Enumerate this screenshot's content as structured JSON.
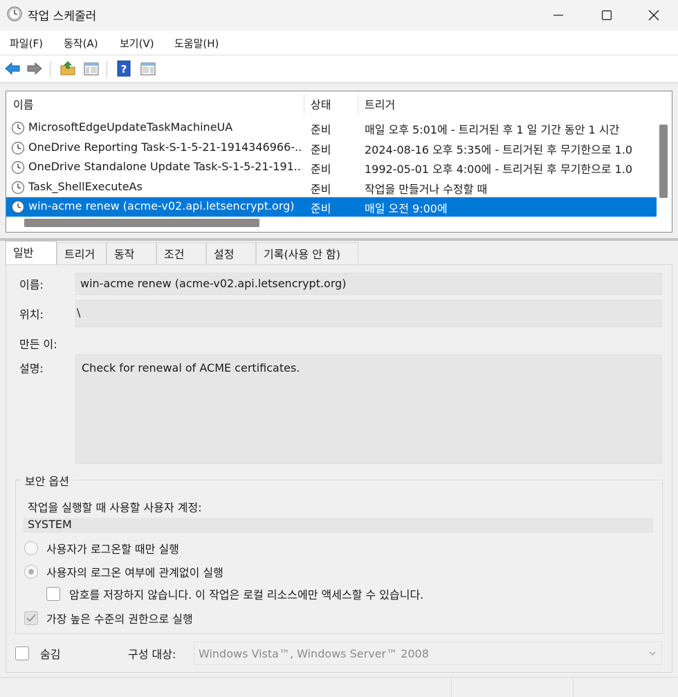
{
  "window": {
    "title": "작업 스케줄러",
    "icon": "clock-icon"
  },
  "menu": {
    "items": [
      "파일(F)",
      "동작(A)",
      "보기(V)",
      "도움말(H)"
    ]
  },
  "toolbar": {
    "buttons": [
      "back-arrow-icon",
      "forward-arrow-icon",
      "folder-up-icon",
      "show-hide-pane-icon",
      "help-icon",
      "action-pane-icon"
    ]
  },
  "task_list": {
    "columns": [
      "이름",
      "상태",
      "트리거"
    ],
    "rows": [
      {
        "name": "MicrosoftEdgeUpdateTaskMachineUA",
        "state": "준비",
        "trigger": "매일 오후 5:01에 - 트리거된 후 1 일 기간 동안 1 시간",
        "selected": false
      },
      {
        "name": "OneDrive Reporting Task-S-1-5-21-1914346966-...",
        "state": "준비",
        "trigger": "2024-08-16 오후 5:35에 - 트리거된 후 무기한으로 1.0",
        "selected": false
      },
      {
        "name": "OneDrive Standalone Update Task-S-1-5-21-191...",
        "state": "준비",
        "trigger": "1992-05-01 오후 4:00에 - 트리거된 후 무기한으로 1.0",
        "selected": false
      },
      {
        "name": "Task_ShellExecuteAs",
        "state": "준비",
        "trigger": "작업을 만들거나 수정할 때",
        "selected": false
      },
      {
        "name": "win-acme renew (acme-v02.api.letsencrypt.org)",
        "state": "준비",
        "trigger": "매일 오전 9:00에",
        "selected": true
      }
    ]
  },
  "tabs": [
    "일반",
    "트리거",
    "동작",
    "조건",
    "설정",
    "기록(사용 안 함)"
  ],
  "general": {
    "name_label": "이름:",
    "name_value": "win-acme renew (acme-v02.api.letsencrypt.org)",
    "location_label": "위치:",
    "location_value": "\\",
    "author_label": "만든 이:",
    "author_value": "",
    "description_label": "설명:",
    "description_value": "Check for renewal of ACME certificates."
  },
  "security": {
    "group_title": "보안 옵션",
    "account_label": "작업을 실행할 때 사용할 사용자 계정:",
    "account_value": "SYSTEM",
    "radio_logged_on_only": "사용자가 로그온할 때만 실행",
    "radio_whether_logged_on": "사용자의 로그온 여부에 관계없이 실행",
    "no_store_password": "암호를 저장하지 않습니다. 이 작업은 로컬 리소스에만 액세스할 수 있습니다.",
    "highest_privileges": "가장 높은 수준의 권한으로 실행"
  },
  "footer": {
    "hidden_label": "숨김",
    "configure_label": "구성 대상:",
    "configure_value": "Windows Vista™, Windows Server™ 2008"
  }
}
